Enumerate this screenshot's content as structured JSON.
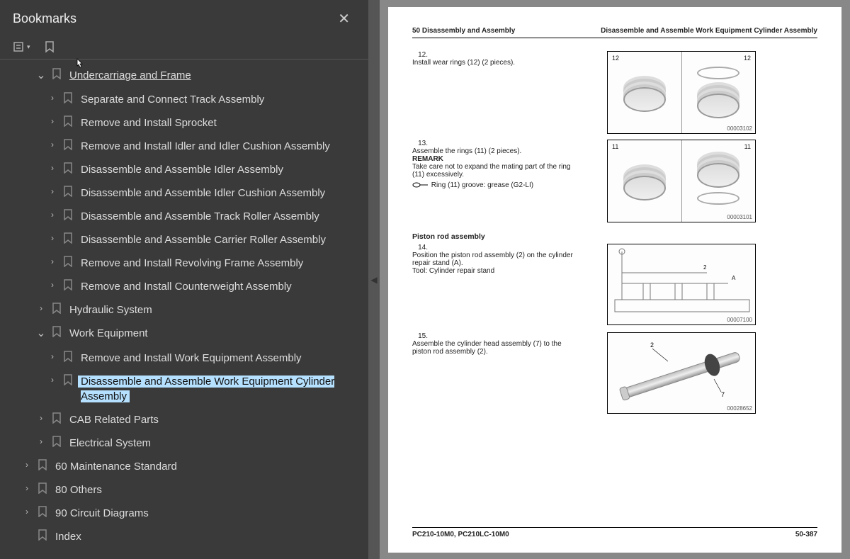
{
  "sidebar": {
    "title": "Bookmarks",
    "items": [
      {
        "label": "Undercarriage and Frame",
        "indent": 1,
        "chevron": "down",
        "underline": true
      },
      {
        "label": "Separate and Connect Track Assembly",
        "indent": 2,
        "chevron": "right"
      },
      {
        "label": "Remove and Install Sprocket",
        "indent": 2,
        "chevron": "right"
      },
      {
        "label": "Remove and Install Idler and Idler Cushion Assembly",
        "indent": 2,
        "chevron": "right"
      },
      {
        "label": "Disassemble and Assemble Idler Assembly",
        "indent": 2,
        "chevron": "right"
      },
      {
        "label": "Disassemble and Assemble Idler Cushion Assembly",
        "indent": 2,
        "chevron": "right"
      },
      {
        "label": "Disassemble and Assemble Track Roller Assembly",
        "indent": 2,
        "chevron": "right"
      },
      {
        "label": "Disassemble and Assemble Carrier Roller Assembly",
        "indent": 2,
        "chevron": "right"
      },
      {
        "label": "Remove and Install Revolving Frame Assembly",
        "indent": 2,
        "chevron": "right"
      },
      {
        "label": "Remove and Install Counterweight Assembly",
        "indent": 2,
        "chevron": "right"
      },
      {
        "label": "Hydraulic System",
        "indent": 1,
        "chevron": "right"
      },
      {
        "label": "Work Equipment",
        "indent": 1,
        "chevron": "down"
      },
      {
        "label": "Remove and Install Work Equipment Assembly",
        "indent": 2,
        "chevron": "right"
      },
      {
        "label": "Disassemble and Assemble Work Equipment Cylinder Assembly",
        "indent": 2,
        "chevron": "right",
        "selected": true
      },
      {
        "label": "CAB Related Parts",
        "indent": 1,
        "chevron": "right"
      },
      {
        "label": "Electrical System",
        "indent": 1,
        "chevron": "right"
      },
      {
        "label": "60 Maintenance Standard",
        "indent": 0,
        "chevron": "right"
      },
      {
        "label": "80 Others",
        "indent": 0,
        "chevron": "right"
      },
      {
        "label": "90 Circuit Diagrams",
        "indent": 0,
        "chevron": "right"
      },
      {
        "label": "Index",
        "indent": 0,
        "chevron": "none"
      }
    ]
  },
  "page": {
    "header_left": "50 Disassembly and Assembly",
    "header_right": "Disassemble and Assemble Work Equipment Cylinder Assembly",
    "steps": {
      "s12": {
        "num": "12.",
        "text": "Install wear rings (12) (2 pieces).",
        "fig_code": "00003102",
        "lbl_a": "12",
        "lbl_b": "12"
      },
      "s13": {
        "num": "13.",
        "text": "Assemble the rings (11) (2 pieces).",
        "remark_label": "REMARK",
        "remark_text": "Take care not to expand the mating part of the ring (11) excessively.",
        "grease": "Ring (11) groove: grease (G2-LI)",
        "fig_code": "00003101",
        "lbl_a": "11",
        "lbl_b": "11"
      },
      "subheading": "Piston rod assembly",
      "s14": {
        "num": "14.",
        "text": "Position the piston rod assembly (2) on the cylinder repair stand (A).",
        "tool": "Tool: Cylinder repair stand",
        "fig_code": "00007100",
        "lbl_a": "A",
        "lbl_b": "2"
      },
      "s15": {
        "num": "15.",
        "text": "Assemble the cylinder head assembly (7) to the piston rod assembly (2).",
        "fig_code": "00028652",
        "lbl_a": "2",
        "lbl_b": "7"
      }
    },
    "footer_left": "PC210-10M0, PC210LC-10M0",
    "footer_right": "50-387"
  }
}
